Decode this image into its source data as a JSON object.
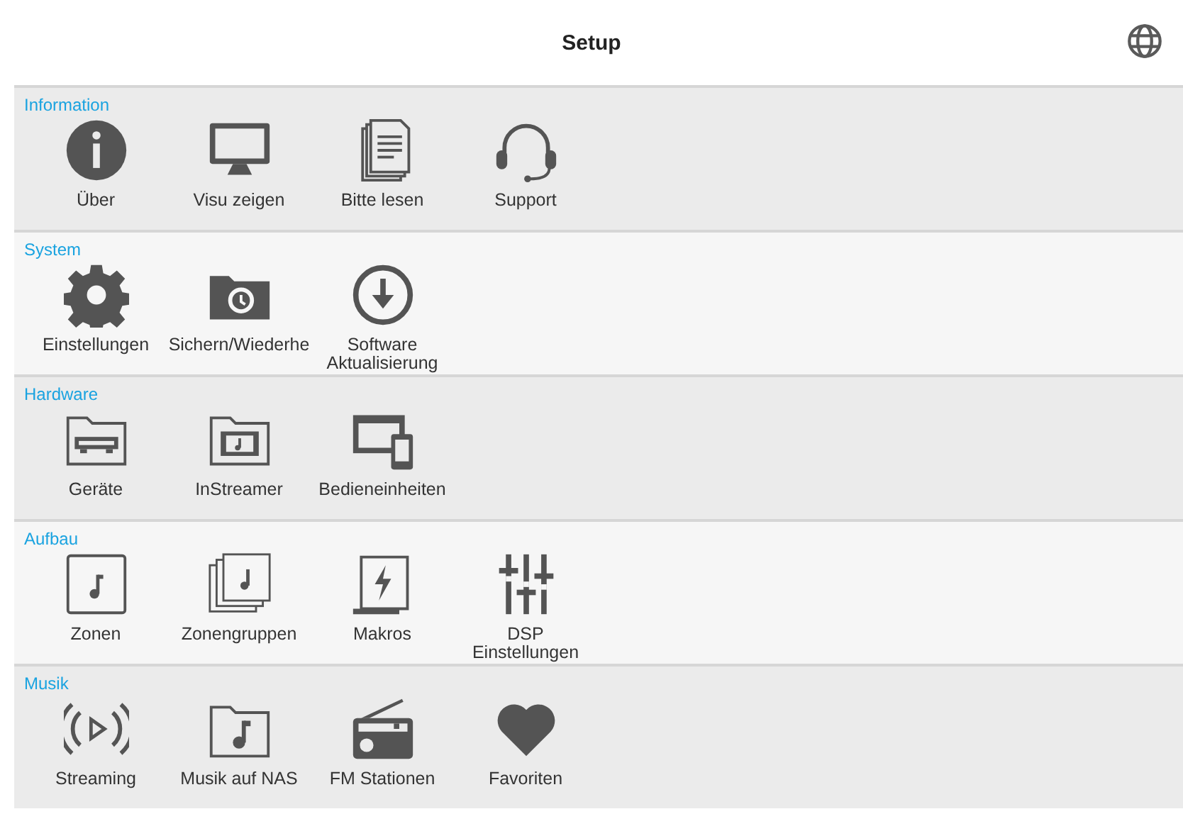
{
  "header": {
    "title": "Setup"
  },
  "sections": [
    {
      "title": "Information",
      "items": [
        {
          "label": "Über"
        },
        {
          "label": "Visu zeigen"
        },
        {
          "label": "Bitte lesen"
        },
        {
          "label": "Support"
        }
      ]
    },
    {
      "title": "System",
      "items": [
        {
          "label": "Einstellungen"
        },
        {
          "label": "Sichern/Wiederhe"
        },
        {
          "label": "Software Aktualisierung"
        }
      ]
    },
    {
      "title": "Hardware",
      "items": [
        {
          "label": "Geräte"
        },
        {
          "label": "InStreamer"
        },
        {
          "label": "Bedieneinheiten"
        }
      ]
    },
    {
      "title": "Aufbau",
      "items": [
        {
          "label": "Zonen"
        },
        {
          "label": "Zonengruppen"
        },
        {
          "label": "Makros"
        },
        {
          "label": "DSP Einstellungen"
        }
      ]
    },
    {
      "title": "Musik",
      "items": [
        {
          "label": "Streaming"
        },
        {
          "label": "Musik auf NAS"
        },
        {
          "label": "FM Stationen"
        },
        {
          "label": "Favoriten"
        }
      ]
    }
  ]
}
